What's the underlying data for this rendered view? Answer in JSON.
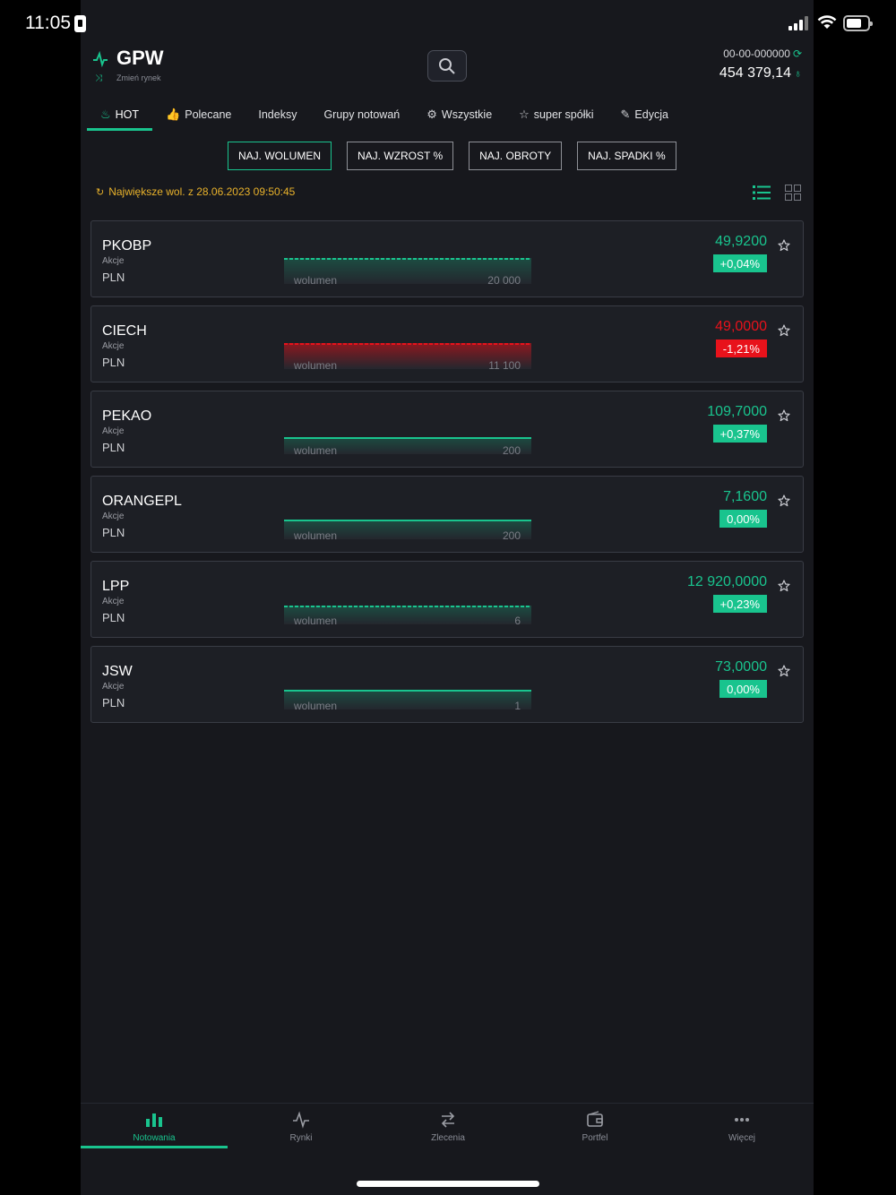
{
  "status_bar": {
    "time": "11:05"
  },
  "header": {
    "market": "GPW",
    "change_market_label": "Zmień rynek",
    "account_number": "00-00-000000",
    "balance": "454 379,14"
  },
  "tabs": [
    {
      "label": "HOT",
      "icon": "fire-icon",
      "active": true
    },
    {
      "label": "Polecane",
      "icon": "thumbs-up-icon"
    },
    {
      "label": "Indeksy",
      "icon": ""
    },
    {
      "label": "Grupy notowań",
      "icon": ""
    },
    {
      "label": "Wszystkie",
      "icon": "gear-icon"
    },
    {
      "label": "super spółki",
      "icon": "star-icon"
    },
    {
      "label": "Edycja",
      "icon": "edit-user-icon"
    }
  ],
  "filters": [
    {
      "label": "NAJ. WOLUMEN",
      "active": true
    },
    {
      "label": "NAJ. WZROST %"
    },
    {
      "label": "NAJ. OBROTY"
    },
    {
      "label": "NAJ. SPADKI %"
    }
  ],
  "updated_text": "Największe wol. z 28.06.2023 09:50:45",
  "volume_label": "wolumen",
  "colors": {
    "accent": "#19c48e",
    "up": "#19c48e",
    "down": "#e8121b",
    "warning": "#e9b22b",
    "background": "#17181d"
  },
  "stocks": [
    {
      "symbol": "PKOBP",
      "type": "Akcje",
      "currency": "PLN",
      "price": "49,9200",
      "change": "+0,04%",
      "direction": "up",
      "volume": "20 000",
      "line_style": "dashed",
      "line_level": 0.9
    },
    {
      "symbol": "CIECH",
      "type": "Akcje",
      "currency": "PLN",
      "price": "49,0000",
      "change": "-1,21%",
      "direction": "down",
      "volume": "11 100",
      "line_style": "dashed",
      "line_level": 0.9
    },
    {
      "symbol": "PEKAO",
      "type": "Akcje",
      "currency": "PLN",
      "price": "109,7000",
      "change": "+0,37%",
      "direction": "up",
      "volume": "200",
      "line_style": "solid",
      "line_level": 0.6
    },
    {
      "symbol": "ORANGEPL",
      "type": "Akcje",
      "currency": "PLN",
      "price": "7,1600",
      "change": "0,00%",
      "direction": "up",
      "volume": "200",
      "line_style": "solid",
      "line_level": 0.7
    },
    {
      "symbol": "LPP",
      "type": "Akcje",
      "currency": "PLN",
      "price": "12 920,0000",
      "change": "+0,23%",
      "direction": "up",
      "volume": "6",
      "line_style": "dashed",
      "line_level": 0.65
    },
    {
      "symbol": "JSW",
      "type": "Akcje",
      "currency": "PLN",
      "price": "73,0000",
      "change": "0,00%",
      "direction": "up",
      "volume": "1",
      "line_style": "solid",
      "line_level": 0.7
    }
  ],
  "bottom_nav": [
    {
      "label": "Notowania",
      "icon": "bar-chart-icon",
      "active": true
    },
    {
      "label": "Rynki",
      "icon": "pulse-icon"
    },
    {
      "label": "Zlecenia",
      "icon": "transfer-arrows-icon"
    },
    {
      "label": "Portfel",
      "icon": "wallet-icon"
    },
    {
      "label": "Więcej",
      "icon": "more-dots-icon"
    }
  ]
}
